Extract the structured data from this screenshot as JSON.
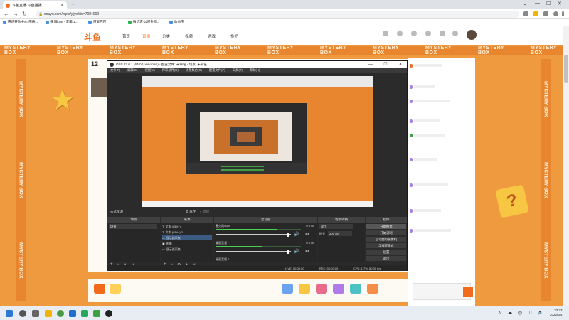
{
  "browser": {
    "tab_title": "斗鱼直播·斗鱼猫播",
    "url": "douyu.com/topic/yljyd/rid=7084009",
    "bookmarks": [
      "腾讯开放中心·用通...",
      "重阳love - 老鹰 1...",
      "阿里巴巴",
      "微信客·公积金网...",
      "收益宝"
    ]
  },
  "site": {
    "logo": "斗鱼",
    "nav": [
      "首页",
      "直播",
      "分类",
      "视频",
      "游戏",
      "鱼吧"
    ],
    "banner_text": "MYSTERY BOX",
    "day_number": "12"
  },
  "obs": {
    "title": "OBS 27.0.1 (64-bit, windows) - 配置文件: 未命名 - 场景: 未命名",
    "menu": [
      "文件(F)",
      "编辑(E)",
      "视图(V)",
      "停靠部件(D)",
      "场景集合(S)",
      "配置文件(P)",
      "工具(T)",
      "帮助(H)"
    ],
    "scene_status": "未选择源",
    "props_label": "属性",
    "filters_label": "滤镜",
    "panels": {
      "scenes": "场景",
      "sources": "来源",
      "mixer": "混音器",
      "transitions": "场景转换",
      "controls": "控件"
    },
    "scene_name": "场景",
    "sources": [
      {
        "name": "文本 (GDI+)",
        "selected": false
      },
      {
        "name": "文本 (GDI+) 2",
        "selected": false
      },
      {
        "name": "显示器采集",
        "selected": true
      },
      {
        "name": "图像",
        "selected": false
      },
      {
        "name": "显示器采集",
        "selected": false
      }
    ],
    "mixer": [
      {
        "name": "麦克风/Aux",
        "db": "0.0 dB",
        "level": 0.72
      },
      {
        "name": "桌面音频",
        "db": "0.0 dB",
        "level": 0.55
      }
    ],
    "mixer_footer": "桌面音频 2",
    "transition_type": "淡出",
    "duration_label": "时长",
    "duration_value": "300 ms",
    "controls": [
      "开始推流",
      "开始录制",
      "启动虚拟摄像机",
      "工作室模式",
      "设置",
      "退出"
    ],
    "status": {
      "live": "LIVE: 00:00:00",
      "rec": "REC: 00:00:00",
      "cpu": "CPU: 1.7%, 60.00 fps"
    }
  },
  "taskbar": {
    "time": "22:23",
    "date": "2022/6/4"
  }
}
